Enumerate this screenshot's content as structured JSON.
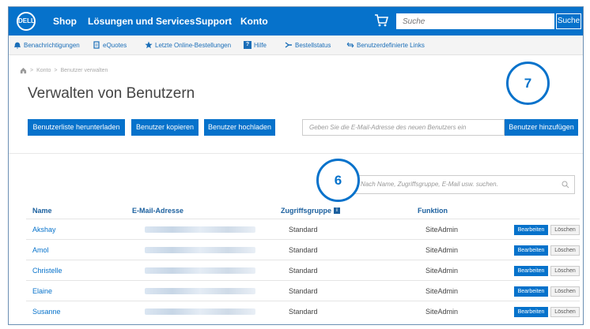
{
  "header": {
    "logo_text": "DELL",
    "nav": [
      "Shop",
      "Lösungen und Services",
      "Support",
      "Konto"
    ],
    "search_placeholder": "Suche",
    "search_button": "Suche"
  },
  "subnav": {
    "items": [
      {
        "label": "Benachrichtigungen",
        "icon": "bell-icon"
      },
      {
        "label": "eQuotes",
        "icon": "document-icon"
      },
      {
        "label": "Letzte Online-Bestellungen",
        "icon": "star-icon"
      },
      {
        "label": "Hilfe",
        "icon": "help-icon"
      },
      {
        "label": "Bestellstatus",
        "icon": "truck-icon"
      },
      {
        "label": "Benutzerdefinierte Links",
        "icon": "link-icon"
      }
    ]
  },
  "breadcrumb": [
    "Konto",
    "Benutzer verwalten"
  ],
  "page": {
    "title": "Verwalten von Benutzern",
    "buttons": {
      "download": "Benutzerliste herunterladen",
      "copy": "Benutzer kopieren",
      "upload": "Benutzer hochladen",
      "add": "Benutzer hinzufügen"
    },
    "email_placeholder": "Geben Sie die E-Mail-Adresse des neuen Benutzers ein",
    "table_search_placeholder": "Nach Name, Zugriffsgruppe, E-Mail usw. suchen."
  },
  "callouts": [
    "7",
    "6"
  ],
  "table": {
    "headers": {
      "name": "Name",
      "email": "E-Mail-Adresse",
      "group": "Zugriffsgruppe",
      "role": "Funktion"
    },
    "rows": [
      {
        "name": "Akshay",
        "group": "Standard",
        "role": "SiteAdmin"
      },
      {
        "name": "Amol",
        "group": "Standard",
        "role": "SiteAdmin"
      },
      {
        "name": "Christelle",
        "group": "Standard",
        "role": "SiteAdmin"
      },
      {
        "name": "Elaine",
        "group": "Standard",
        "role": "SiteAdmin"
      },
      {
        "name": "Susanne",
        "group": "Standard",
        "role": "SiteAdmin"
      }
    ],
    "edit_label": "Bearbeiten",
    "delete_label": "Löschen"
  },
  "colors": {
    "brand": "#0672cb",
    "header_text": "#1a5f9e"
  }
}
